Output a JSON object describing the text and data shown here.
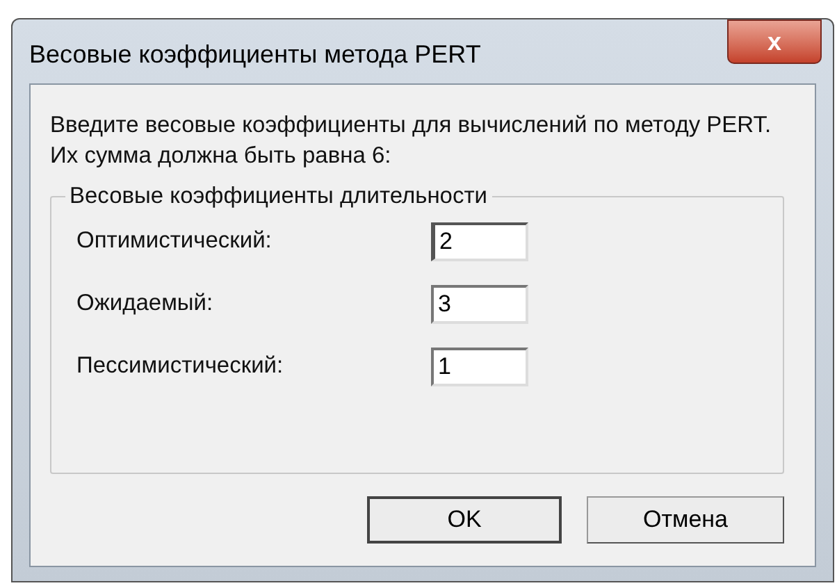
{
  "window": {
    "title": "Весовые коэффициенты метода PERT",
    "close": "x"
  },
  "intro": "Введите весовые коэффициенты для вычислений по методу PERT. Их сумма должна быть равна 6:",
  "group": {
    "title": "Весовые коэффициенты длительности",
    "fields": [
      {
        "label": "Оптимистический:",
        "value": "2",
        "focused": true
      },
      {
        "label": "Ожидаемый:",
        "value": "3",
        "focused": false
      },
      {
        "label": "Пессимистический:",
        "value": "1",
        "focused": false
      }
    ]
  },
  "buttons": [
    {
      "label": "OK",
      "default": true
    },
    {
      "label": "Отмена",
      "default": false
    }
  ]
}
